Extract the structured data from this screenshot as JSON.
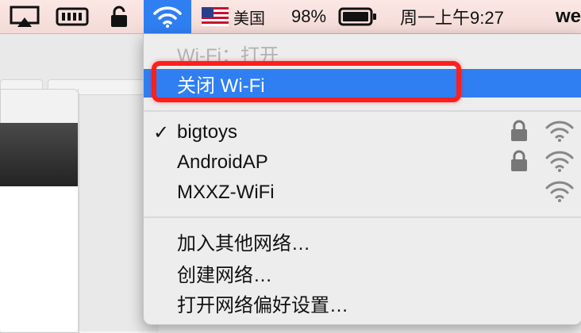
{
  "menubar": {
    "region_label": "美国",
    "battery_percent": "98%",
    "clock": "周一上午9:27",
    "user": "we"
  },
  "wifi_menu": {
    "status": "Wi-Fi：打开",
    "toggle_label": "关闭 Wi-Fi",
    "networks": [
      {
        "name": "bigtoys",
        "connected": true,
        "locked": true
      },
      {
        "name": "AndroidAP",
        "connected": false,
        "locked": true
      },
      {
        "name": "MXXZ-WiFi",
        "connected": false,
        "locked": false
      }
    ],
    "actions": {
      "join_other": "加入其他网络…",
      "create": "创建网络…",
      "preferences": "打开网络偏好设置…"
    },
    "checkmark": "✓"
  },
  "colors": {
    "accent": "#2f7ff2",
    "highlight": "#ff1f1f"
  },
  "icons": [
    "airplay-icon",
    "memory-icon",
    "lock-icon",
    "wifi-icon",
    "us-flag-icon",
    "battery-icon",
    "wifi-signal-icon",
    "lock-small-icon"
  ]
}
